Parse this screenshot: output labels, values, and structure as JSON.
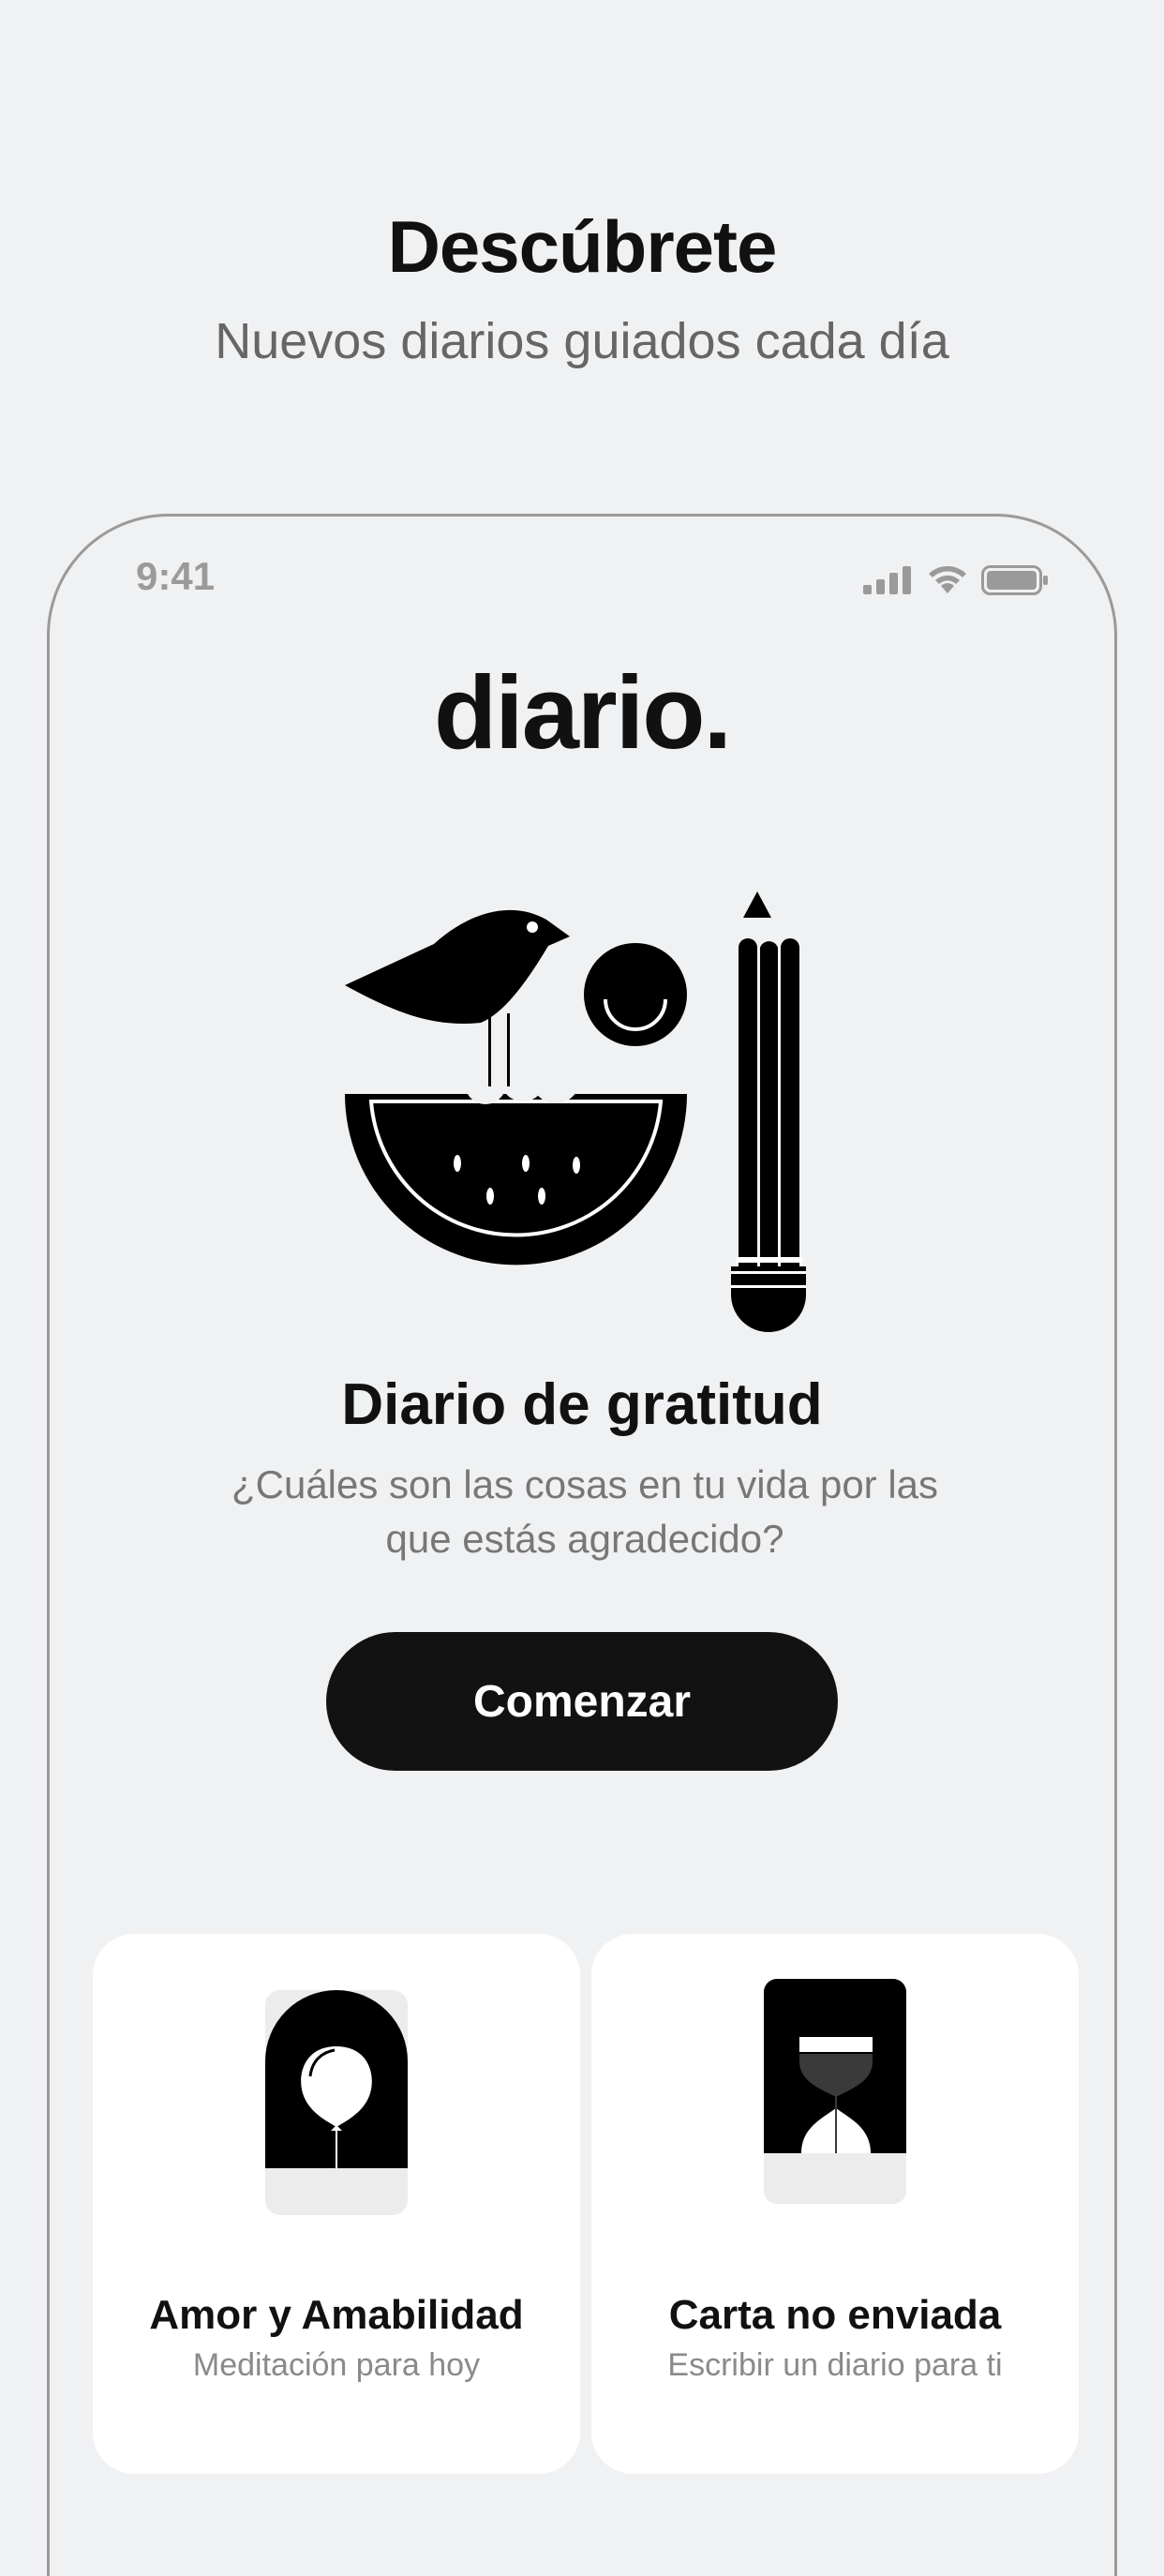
{
  "header": {
    "title": "Descúbrete",
    "subtitle": "Nuevos diarios guiados cada día"
  },
  "status_bar": {
    "time": "9:41",
    "icons": [
      "signal-icon",
      "wifi-icon",
      "battery-icon"
    ]
  },
  "app": {
    "brand": "diario."
  },
  "featured": {
    "illustration": "bird-watermelon-smile-pencil-illustration",
    "title": "Diario de gratitud",
    "description": "¿Cuáles son las cosas en tu vida por las que estás agradecido?",
    "button_label": "Comenzar"
  },
  "cards": [
    {
      "illustration": "balloon-arch-illustration",
      "title": "Amor y Amabilidad",
      "subtitle": "Meditación para hoy"
    },
    {
      "illustration": "hourglass-illustration",
      "title": "Carta no enviada",
      "subtitle": "Escribir un diario para ti"
    }
  ],
  "colors": {
    "background": "#f0f1f3",
    "primary": "#121212",
    "card": "#ffffff",
    "muted_text": "#777777"
  }
}
